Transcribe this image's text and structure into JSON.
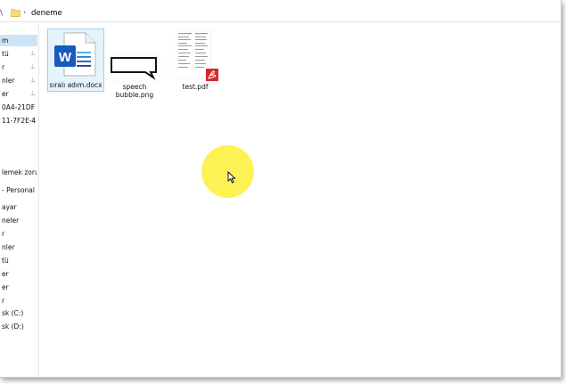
{
  "address": {
    "nav_fragment": "\\",
    "folder_name": "deneme"
  },
  "sidebar": {
    "items": [
      {
        "label": "m",
        "pinned": false,
        "selected": true
      },
      {
        "label": "tü",
        "pinned": true
      },
      {
        "label": "r",
        "pinned": true
      },
      {
        "label": "nler",
        "pinned": true
      },
      {
        "label": "er",
        "pinned": true
      },
      {
        "label": "0A4-21DF",
        "pinned": true
      },
      {
        "label": "11-7F2E-4",
        "pinned": true
      },
      {
        "label": "lemek zorur",
        "pinned": false
      },
      {
        "label": "- Personal",
        "pinned": false
      },
      {
        "label": "ayar",
        "pinned": false
      },
      {
        "label": "neler",
        "pinned": false
      },
      {
        "label": "r",
        "pinned": false
      },
      {
        "label": "nler",
        "pinned": false
      },
      {
        "label": "tü",
        "pinned": false
      },
      {
        "label": "er",
        "pinned": false
      },
      {
        "label": "er",
        "pinned": false
      },
      {
        "label": "r",
        "pinned": false
      },
      {
        "label": "sk (C:)",
        "pinned": false
      },
      {
        "label": "sk (D:)",
        "pinned": false
      }
    ],
    "pin_glyph": "📌"
  },
  "files": [
    {
      "name": "sıralı adım.docx",
      "icon": "word-document-icon",
      "selected": true
    },
    {
      "name_line1": "speech",
      "name_line2": "bubble.png",
      "icon": "speech-bubble-thumbnail"
    },
    {
      "name": "test.pdf",
      "icon": "pdf-document-thumbnail"
    }
  ],
  "colors": {
    "selection_bg": "#cce4f7",
    "tile_selected_bg": "#e5f3fb",
    "word_blue": "#185abd",
    "pdf_red": "#d3282e",
    "cursor_highlight": "#fdf14a"
  }
}
